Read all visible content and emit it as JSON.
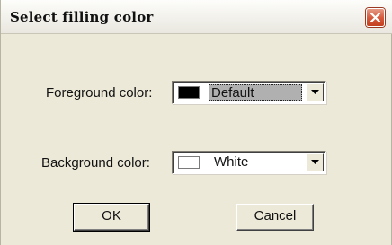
{
  "dialog": {
    "title": "Select filling color",
    "close_icon": "close-icon"
  },
  "foreground": {
    "label": "Foreground color:",
    "value": "Default",
    "swatch_color": "#000000"
  },
  "background": {
    "label": "Background color:",
    "value": "White",
    "swatch_color": "#ffffff"
  },
  "buttons": {
    "ok": "OK",
    "cancel": "Cancel"
  }
}
